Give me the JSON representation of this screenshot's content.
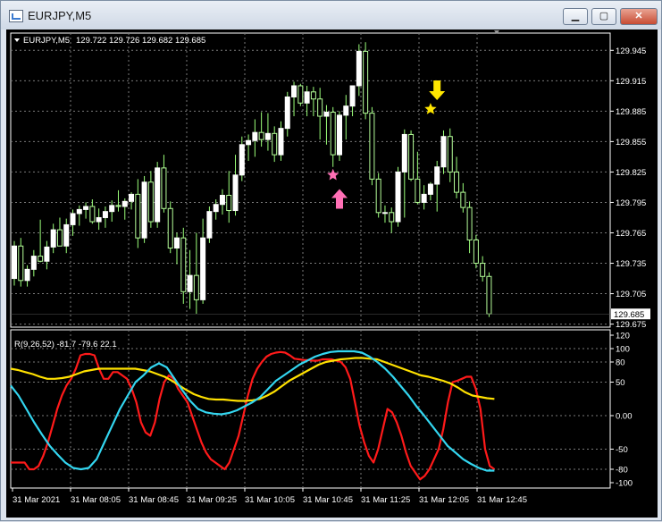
{
  "window": {
    "title": "EURJPY,M5",
    "icon": "chart-icon",
    "buttons": {
      "minimize": "▁",
      "maximize": "▢",
      "close": "✕"
    }
  },
  "chart_data": [
    {
      "type": "candlestick",
      "symbol_label": "EURJPY,M5",
      "ohlc_label": "129.722 129.726 129.682 129.685",
      "current_price": "129.685",
      "y_ticks": [
        "129.945",
        "129.915",
        "129.885",
        "129.855",
        "129.825",
        "129.795",
        "129.765",
        "129.735",
        "129.705",
        "129.675"
      ],
      "ylim": [
        129.672,
        129.962
      ],
      "colors": {
        "bull": "#ffffff",
        "bear": "#b6ff9a",
        "wick": "#9bff7a",
        "grid": "#7a7a7a"
      },
      "candles": [
        [
          129.72,
          129.757,
          129.713,
          129.752
        ],
        [
          129.752,
          129.76,
          129.712,
          129.718
        ],
        [
          129.718,
          129.733,
          129.712,
          129.729
        ],
        [
          129.729,
          129.748,
          129.722,
          129.742
        ],
        [
          129.742,
          129.778,
          129.736,
          129.737
        ],
        [
          129.737,
          129.757,
          129.729,
          129.751
        ],
        [
          129.751,
          129.774,
          129.745,
          129.768
        ],
        [
          129.768,
          129.78,
          129.752,
          129.752
        ],
        [
          129.752,
          129.779,
          129.745,
          129.773
        ],
        [
          129.773,
          129.788,
          129.762,
          129.784
        ],
        [
          129.784,
          129.792,
          129.772,
          129.788
        ],
        [
          129.788,
          129.795,
          129.779,
          129.791
        ],
        [
          129.791,
          129.798,
          129.774,
          129.776
        ],
        [
          129.776,
          129.789,
          129.768,
          129.78
        ],
        [
          129.78,
          129.791,
          129.77,
          129.786
        ],
        [
          129.786,
          129.797,
          129.776,
          129.792
        ],
        [
          129.792,
          129.807,
          129.786,
          129.791
        ],
        [
          129.791,
          129.799,
          129.778,
          129.796
        ],
        [
          129.796,
          129.805,
          129.788,
          129.803
        ],
        [
          129.803,
          129.818,
          129.75,
          129.76
        ],
        [
          129.76,
          129.821,
          129.755,
          129.815
        ],
        [
          129.815,
          129.826,
          129.77,
          129.776
        ],
        [
          129.776,
          129.835,
          129.77,
          129.829
        ],
        [
          129.829,
          129.842,
          129.785,
          129.789
        ],
        [
          129.789,
          129.796,
          129.745,
          129.75
        ],
        [
          129.75,
          129.765,
          129.734,
          129.76
        ],
        [
          129.76,
          129.77,
          129.695,
          129.707
        ],
        [
          129.707,
          129.748,
          129.69,
          129.723
        ],
        [
          129.723,
          129.765,
          129.685,
          129.699
        ],
        [
          129.699,
          129.779,
          129.695,
          129.76
        ],
        [
          129.76,
          129.791,
          129.755,
          129.786
        ],
        [
          129.786,
          129.798,
          129.778,
          129.793
        ],
        [
          129.793,
          129.808,
          129.783,
          129.802
        ],
        [
          129.802,
          129.826,
          129.775,
          129.787
        ],
        [
          129.787,
          129.842,
          129.782,
          129.822
        ],
        [
          129.822,
          129.86,
          129.816,
          129.852
        ],
        [
          129.852,
          129.862,
          129.836,
          129.856
        ],
        [
          129.856,
          129.877,
          129.84,
          129.864
        ],
        [
          129.864,
          129.884,
          129.85,
          129.857
        ],
        [
          129.857,
          129.883,
          129.846,
          129.863
        ],
        [
          129.863,
          129.87,
          129.835,
          129.842
        ],
        [
          129.842,
          129.875,
          129.836,
          129.868
        ],
        [
          129.868,
          129.904,
          129.86,
          129.899
        ],
        [
          129.899,
          129.914,
          129.88,
          129.91
        ],
        [
          129.91,
          129.912,
          129.89,
          129.893
        ],
        [
          129.893,
          129.91,
          129.88,
          129.904
        ],
        [
          129.904,
          129.909,
          129.88,
          129.897
        ],
        [
          129.897,
          129.908,
          129.857,
          129.88
        ],
        [
          129.88,
          129.891,
          129.852,
          129.884
        ],
        [
          129.884,
          129.889,
          129.83,
          129.842
        ],
        [
          129.842,
          129.885,
          129.836,
          129.881
        ],
        [
          129.881,
          129.901,
          129.857,
          129.89
        ],
        [
          129.89,
          129.91,
          129.88,
          129.91
        ],
        [
          129.91,
          129.951,
          129.9,
          129.944
        ],
        [
          129.944,
          129.953,
          129.877,
          129.883
        ],
        [
          129.883,
          129.889,
          129.812,
          129.818
        ],
        [
          129.818,
          129.824,
          129.78,
          129.785
        ],
        [
          129.785,
          129.792,
          129.775,
          129.785
        ],
        [
          129.785,
          129.79,
          129.765,
          129.776
        ],
        [
          129.776,
          129.83,
          129.771,
          129.825
        ],
        [
          129.825,
          129.867,
          129.78,
          129.862
        ],
        [
          129.862,
          129.866,
          129.816,
          129.818
        ],
        [
          129.818,
          129.845,
          129.793,
          129.795
        ],
        [
          129.795,
          129.812,
          129.788,
          129.803
        ],
        [
          129.803,
          129.815,
          129.797,
          129.813
        ],
        [
          129.813,
          129.836,
          129.786,
          129.83
        ],
        [
          129.83,
          129.866,
          129.823,
          129.86
        ],
        [
          129.86,
          129.868,
          129.815,
          129.825
        ],
        [
          129.825,
          129.84,
          129.799,
          129.805
        ],
        [
          129.805,
          129.814,
          129.785,
          129.79
        ],
        [
          129.79,
          129.796,
          129.745,
          129.758
        ],
        [
          129.758,
          129.763,
          129.73,
          129.735
        ],
        [
          129.735,
          129.742,
          129.717,
          129.722
        ],
        [
          129.722,
          129.726,
          129.682,
          129.685
        ]
      ],
      "markers": [
        {
          "kind": "star",
          "name": "pink-star-marker",
          "color": "#ff6fb5",
          "x_index": 49,
          "y": 129.822
        },
        {
          "kind": "up-arrow",
          "name": "pink-up-arrow",
          "color": "#ff6fb5",
          "x_index": 50,
          "y": 129.81
        },
        {
          "kind": "star",
          "name": "yellow-star-marker",
          "color": "#ffe600",
          "x_index": 64,
          "y": 129.887
        },
        {
          "kind": "down-arrow",
          "name": "yellow-down-arrow",
          "color": "#ffe600",
          "x_index": 65,
          "y": 129.895
        }
      ]
    },
    {
      "type": "line",
      "label": "R(9,26,52) -81.7 -79.6 22.1",
      "y_ticks": [
        "120",
        "100",
        "80",
        "50",
        "0.00",
        "-50",
        "-80",
        "-100"
      ],
      "ylim": [
        -108,
        128
      ],
      "series": [
        {
          "color": "#ff1a1a",
          "values": [
            -70,
            -70,
            -70,
            -70,
            -80,
            -80,
            -75,
            -60,
            -40,
            -15,
            10,
            30,
            45,
            55,
            70,
            90,
            92,
            92,
            90,
            70,
            55,
            55,
            65,
            65,
            60,
            55,
            40,
            20,
            -10,
            -25,
            -30,
            -10,
            25,
            50,
            60,
            55,
            40,
            30,
            20,
            0,
            -20,
            -40,
            -55,
            -65,
            -70,
            -75,
            -80,
            -70,
            -50,
            -30,
            0,
            30,
            55,
            70,
            80,
            88,
            92,
            94,
            95,
            94,
            90,
            85,
            84,
            83,
            83,
            82,
            82,
            84,
            84,
            84,
            82,
            80,
            72,
            55,
            20,
            -15,
            -40,
            -60,
            -70,
            -50,
            -20,
            10,
            5,
            -10,
            -30,
            -55,
            -75,
            -85,
            -95,
            -90,
            -80,
            -65,
            -50,
            -20,
            20,
            50,
            52,
            55,
            58,
            58,
            40,
            10,
            -50,
            -75,
            -80
          ]
        },
        {
          "color": "#ffe100",
          "values": [
            70,
            68,
            65,
            62,
            58,
            55,
            55,
            56,
            58,
            62,
            66,
            68,
            70,
            70,
            70,
            70,
            70,
            70,
            68,
            66,
            62,
            58,
            52,
            45,
            38,
            32,
            28,
            25,
            24,
            24,
            23,
            22,
            22,
            23,
            25,
            30,
            36,
            44,
            52,
            58,
            64,
            70,
            76,
            80,
            82,
            84,
            85,
            86,
            86,
            85,
            84,
            80,
            76,
            72,
            68,
            64,
            60,
            58,
            55,
            52,
            48,
            42,
            35,
            30,
            28,
            26,
            25
          ]
        },
        {
          "color": "#33d6f0",
          "values": [
            45,
            30,
            10,
            -10,
            -28,
            -45,
            -58,
            -70,
            -78,
            -80,
            -78,
            -65,
            -40,
            -15,
            10,
            30,
            50,
            60,
            72,
            78,
            72,
            55,
            38,
            22,
            10,
            5,
            3,
            2,
            4,
            8,
            14,
            20,
            28,
            40,
            52,
            60,
            68,
            76,
            82,
            88,
            92,
            95,
            96,
            96,
            96,
            94,
            88,
            80,
            70,
            58,
            44,
            30,
            14,
            0,
            -15,
            -30,
            -45,
            -55,
            -65,
            -72,
            -78,
            -82,
            -82
          ]
        }
      ],
      "lengths_in_candles": [
        74,
        74,
        74
      ]
    }
  ],
  "x_ticks": [
    "31 Mar 2021",
    "31 Mar 08:05",
    "31 Mar 08:45",
    "31 Mar 09:25",
    "31 Mar 10:05",
    "31 Mar 10:45",
    "31 Mar 11:25",
    "31 Mar 12:05",
    "31 Mar 12:45"
  ]
}
